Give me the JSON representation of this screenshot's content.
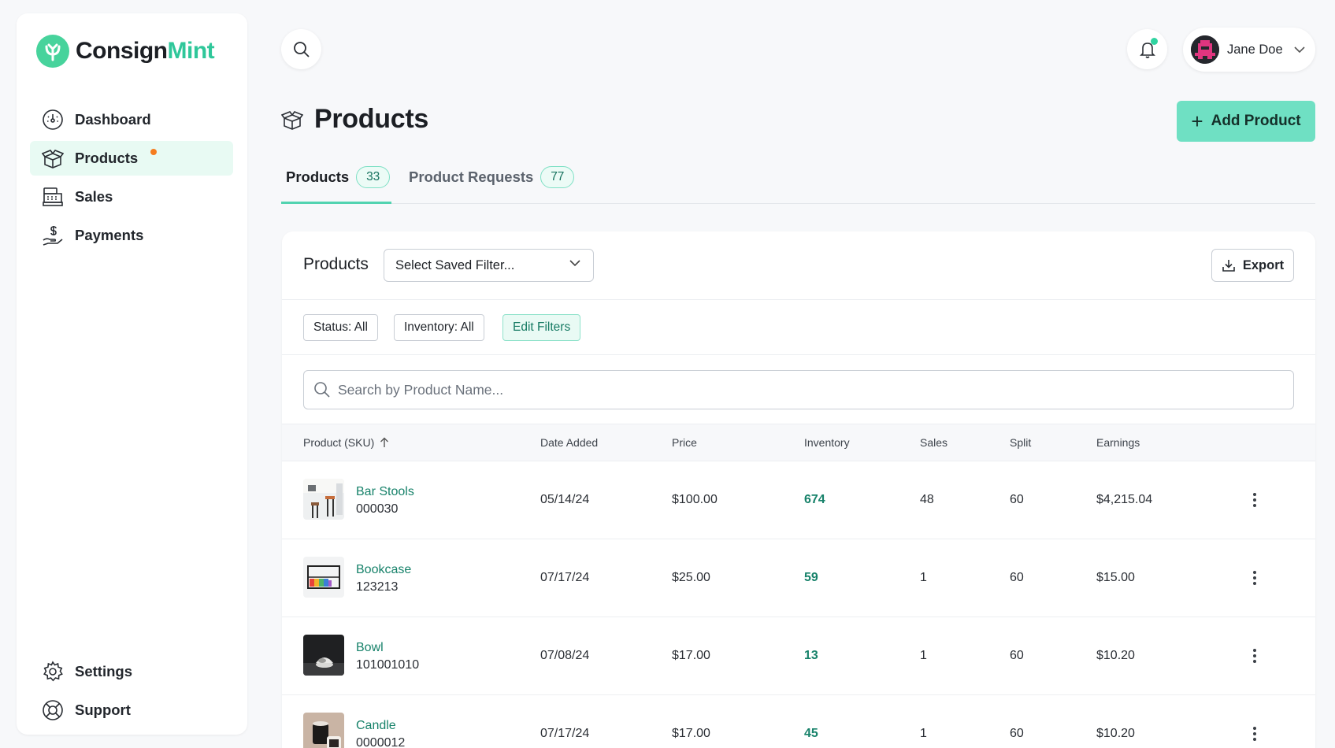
{
  "brand": {
    "name_part1": "Consign",
    "name_part2": "Mint",
    "accent": "#2fc79a"
  },
  "sidebar": {
    "items": [
      {
        "label": "Dashboard",
        "icon": "dashboard-gauge-icon"
      },
      {
        "label": "Products",
        "icon": "box-icon",
        "active": true,
        "has_dot": true
      },
      {
        "label": "Sales",
        "icon": "cash-register-icon"
      },
      {
        "label": "Payments",
        "icon": "hand-dollar-icon"
      }
    ],
    "bottom_items": [
      {
        "label": "Settings",
        "icon": "gear-icon"
      },
      {
        "label": "Support",
        "icon": "lifebuoy-icon"
      }
    ]
  },
  "topbar": {
    "user_name": "Jane Doe",
    "notification_dot": true
  },
  "header": {
    "title": "Products",
    "add_button": "Add Product"
  },
  "tabs": [
    {
      "label": "Products",
      "count": "33",
      "active": true
    },
    {
      "label": "Product Requests",
      "count": "77"
    }
  ],
  "card": {
    "title": "Products",
    "saved_filter": "Select Saved Filter...",
    "export_label": "Export",
    "chips": {
      "status": "Status: All",
      "inventory": "Inventory: All",
      "edit": "Edit Filters"
    },
    "search_placeholder": "Search by Product Name..."
  },
  "table": {
    "columns": [
      "Product (SKU)",
      "Date Added",
      "Price",
      "Inventory",
      "Sales",
      "Split",
      "Earnings"
    ],
    "rows": [
      {
        "name": "Bar Stools",
        "sku": "000030",
        "date": "05/14/24",
        "price": "$100.00",
        "inventory": "674",
        "sales": "48",
        "split": "60",
        "earnings": "$4,215.04"
      },
      {
        "name": "Bookcase",
        "sku": "123213",
        "date": "07/17/24",
        "price": "$25.00",
        "inventory": "59",
        "sales": "1",
        "split": "60",
        "earnings": "$15.00"
      },
      {
        "name": "Bowl",
        "sku": "101001010",
        "date": "07/08/24",
        "price": "$17.00",
        "inventory": "13",
        "sales": "1",
        "split": "60",
        "earnings": "$10.20"
      },
      {
        "name": "Candle",
        "sku": "0000012",
        "date": "07/17/24",
        "price": "$17.00",
        "inventory": "45",
        "sales": "1",
        "split": "60",
        "earnings": "$10.20"
      }
    ]
  }
}
